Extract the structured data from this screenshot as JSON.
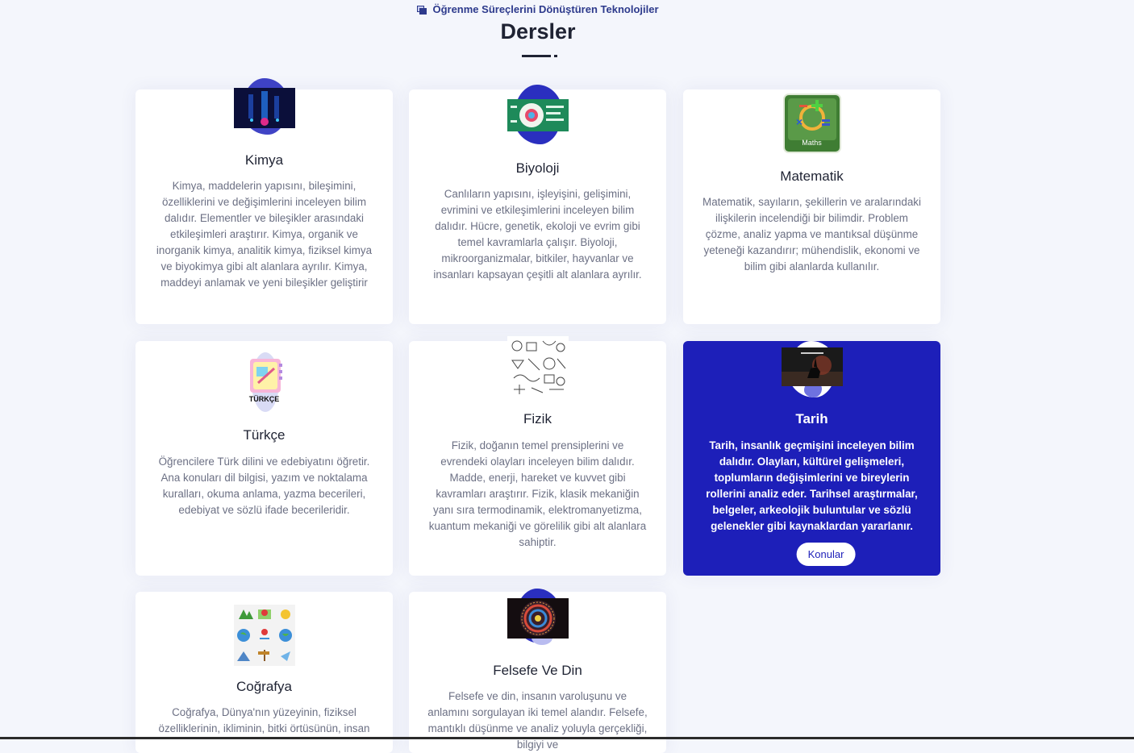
{
  "header": {
    "eyebrow": "Öğrenme Süreçlerini Dönüştüren Teknolojiler",
    "title": "Dersler"
  },
  "colors": {
    "accent": "#1d1fb9",
    "card_bg": "#ffffff",
    "page_bg": "#f4f6fc",
    "text_muted": "#6c7084"
  },
  "cards": [
    {
      "title": "Kimya",
      "icon": "chemistry-thumbnail-icon",
      "description": "Kimya, maddelerin yapısını, bileşimini, özelliklerini ve değişimlerini inceleyen bilim dalıdır. Elementler ve bileşikler arasındaki etkileşimleri araştırır. Kimya, organik ve inorganik kimya, analitik kimya, fiziksel kimya ve biyokimya gibi alt alanlara ayrılır. Kimya, maddeyi anlamak ve yeni bileşikler geliştirir"
    },
    {
      "title": "Biyoloji",
      "icon": "biology-thumbnail-icon",
      "description": "Canlıların yapısını, işleyişini, gelişimini, evrimini ve etkileşimlerini inceleyen bilim dalıdır. Hücre, genetik, ekoloji ve evrim gibi temel kavramlarla çalışır. Biyoloji, mikroorganizmalar, bitkiler, hayvanlar ve insanları kapsayan çeşitli alt alanlara ayrılır."
    },
    {
      "title": "Matematik",
      "icon": "maths-thumbnail-icon",
      "icon_label": "Maths",
      "description": "Matematik, sayıların, şekillerin ve aralarındaki ilişkilerin incelendiği bir bilimdir. Problem çözme, analiz yapma ve mantıksal düşünme yeteneği kazandırır; mühendislik, ekonomi ve bilim gibi alanlarda kullanılır."
    },
    {
      "title": "Türkçe",
      "icon": "turkish-notebook-icon",
      "icon_label": "TÜRKÇE",
      "description": "Öğrencilere Türk dilini ve edebiyatını öğretir. Ana konuları dil bilgisi, yazım ve noktalama kuralları, okuma anlama, yazma becerileri, edebiyat ve sözlü ifade becerileridir."
    },
    {
      "title": "Fizik",
      "icon": "physics-doodles-icon",
      "description": "Fizik, doğanın temel prensiplerini ve evrendeki olayları inceleyen bilim dalıdır. Madde, enerji, hareket ve kuvvet gibi kavramları araştırır. Fizik, klasik mekaniğin yanı sıra termodinamik, elektromanyetizma, kuantum mekaniği ve görelilik gibi alt alanlara sahiptir."
    },
    {
      "title": "Tarih",
      "icon": "history-horseman-icon",
      "active": true,
      "button": "Konular",
      "description": "Tarih, insanlık geçmişini inceleyen bilim dalıdır. Olayları, kültürel gelişmeleri, toplumların değişimlerini ve bireylerin rollerini analiz eder. Tarihsel araştırmalar, belgeler, arkeolojik buluntular ve sözlü gelenekler gibi kaynaklardan yararlanır."
    },
    {
      "title": "Coğrafya",
      "icon": "geography-icons-grid-icon",
      "description": "Coğrafya, Dünya'nın yüzeyinin, fiziksel özelliklerinin, ikliminin, bitki örtüsünün, insan"
    },
    {
      "title": "Felsefe Ve Din",
      "icon": "stained-glass-icon",
      "description": "Felsefe ve din, insanın varoluşunu ve anlamını sorgulayan iki temel alandır. Felsefe, mantıklı düşünme ve analiz yoluyla gerçekliği, bilgiyi ve"
    }
  ]
}
